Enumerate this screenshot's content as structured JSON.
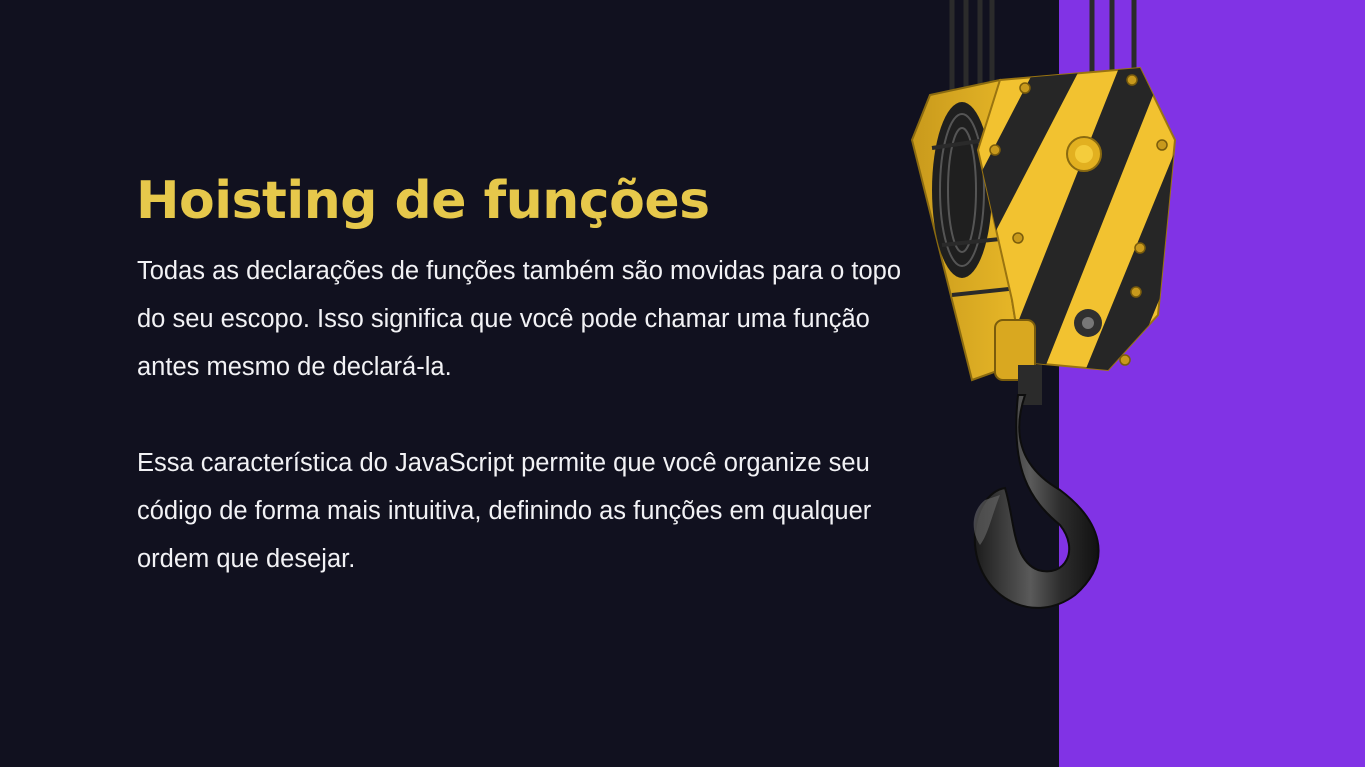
{
  "slide": {
    "title": "Hoisting de funções",
    "paragraph_1": "Todas as declarações de funções também são movidas para o topo do seu escopo.  Isso significa que você pode chamar uma função antes mesmo de declará-la.",
    "paragraph_2": "Essa característica do JavaScript permite que você organize seu código de forma mais intuitiva, definindo as funções em qualquer ordem que desejar."
  },
  "colors": {
    "background": "#11111f",
    "accent_panel": "#8133e5",
    "title": "#e6c84b",
    "text": "#f2f2f5",
    "hook_yellow": "#f2c230",
    "hook_stripe": "#262626",
    "hook_metal": "#3a3a3a"
  },
  "icons": {
    "illustration": "crane-hook-icon"
  }
}
